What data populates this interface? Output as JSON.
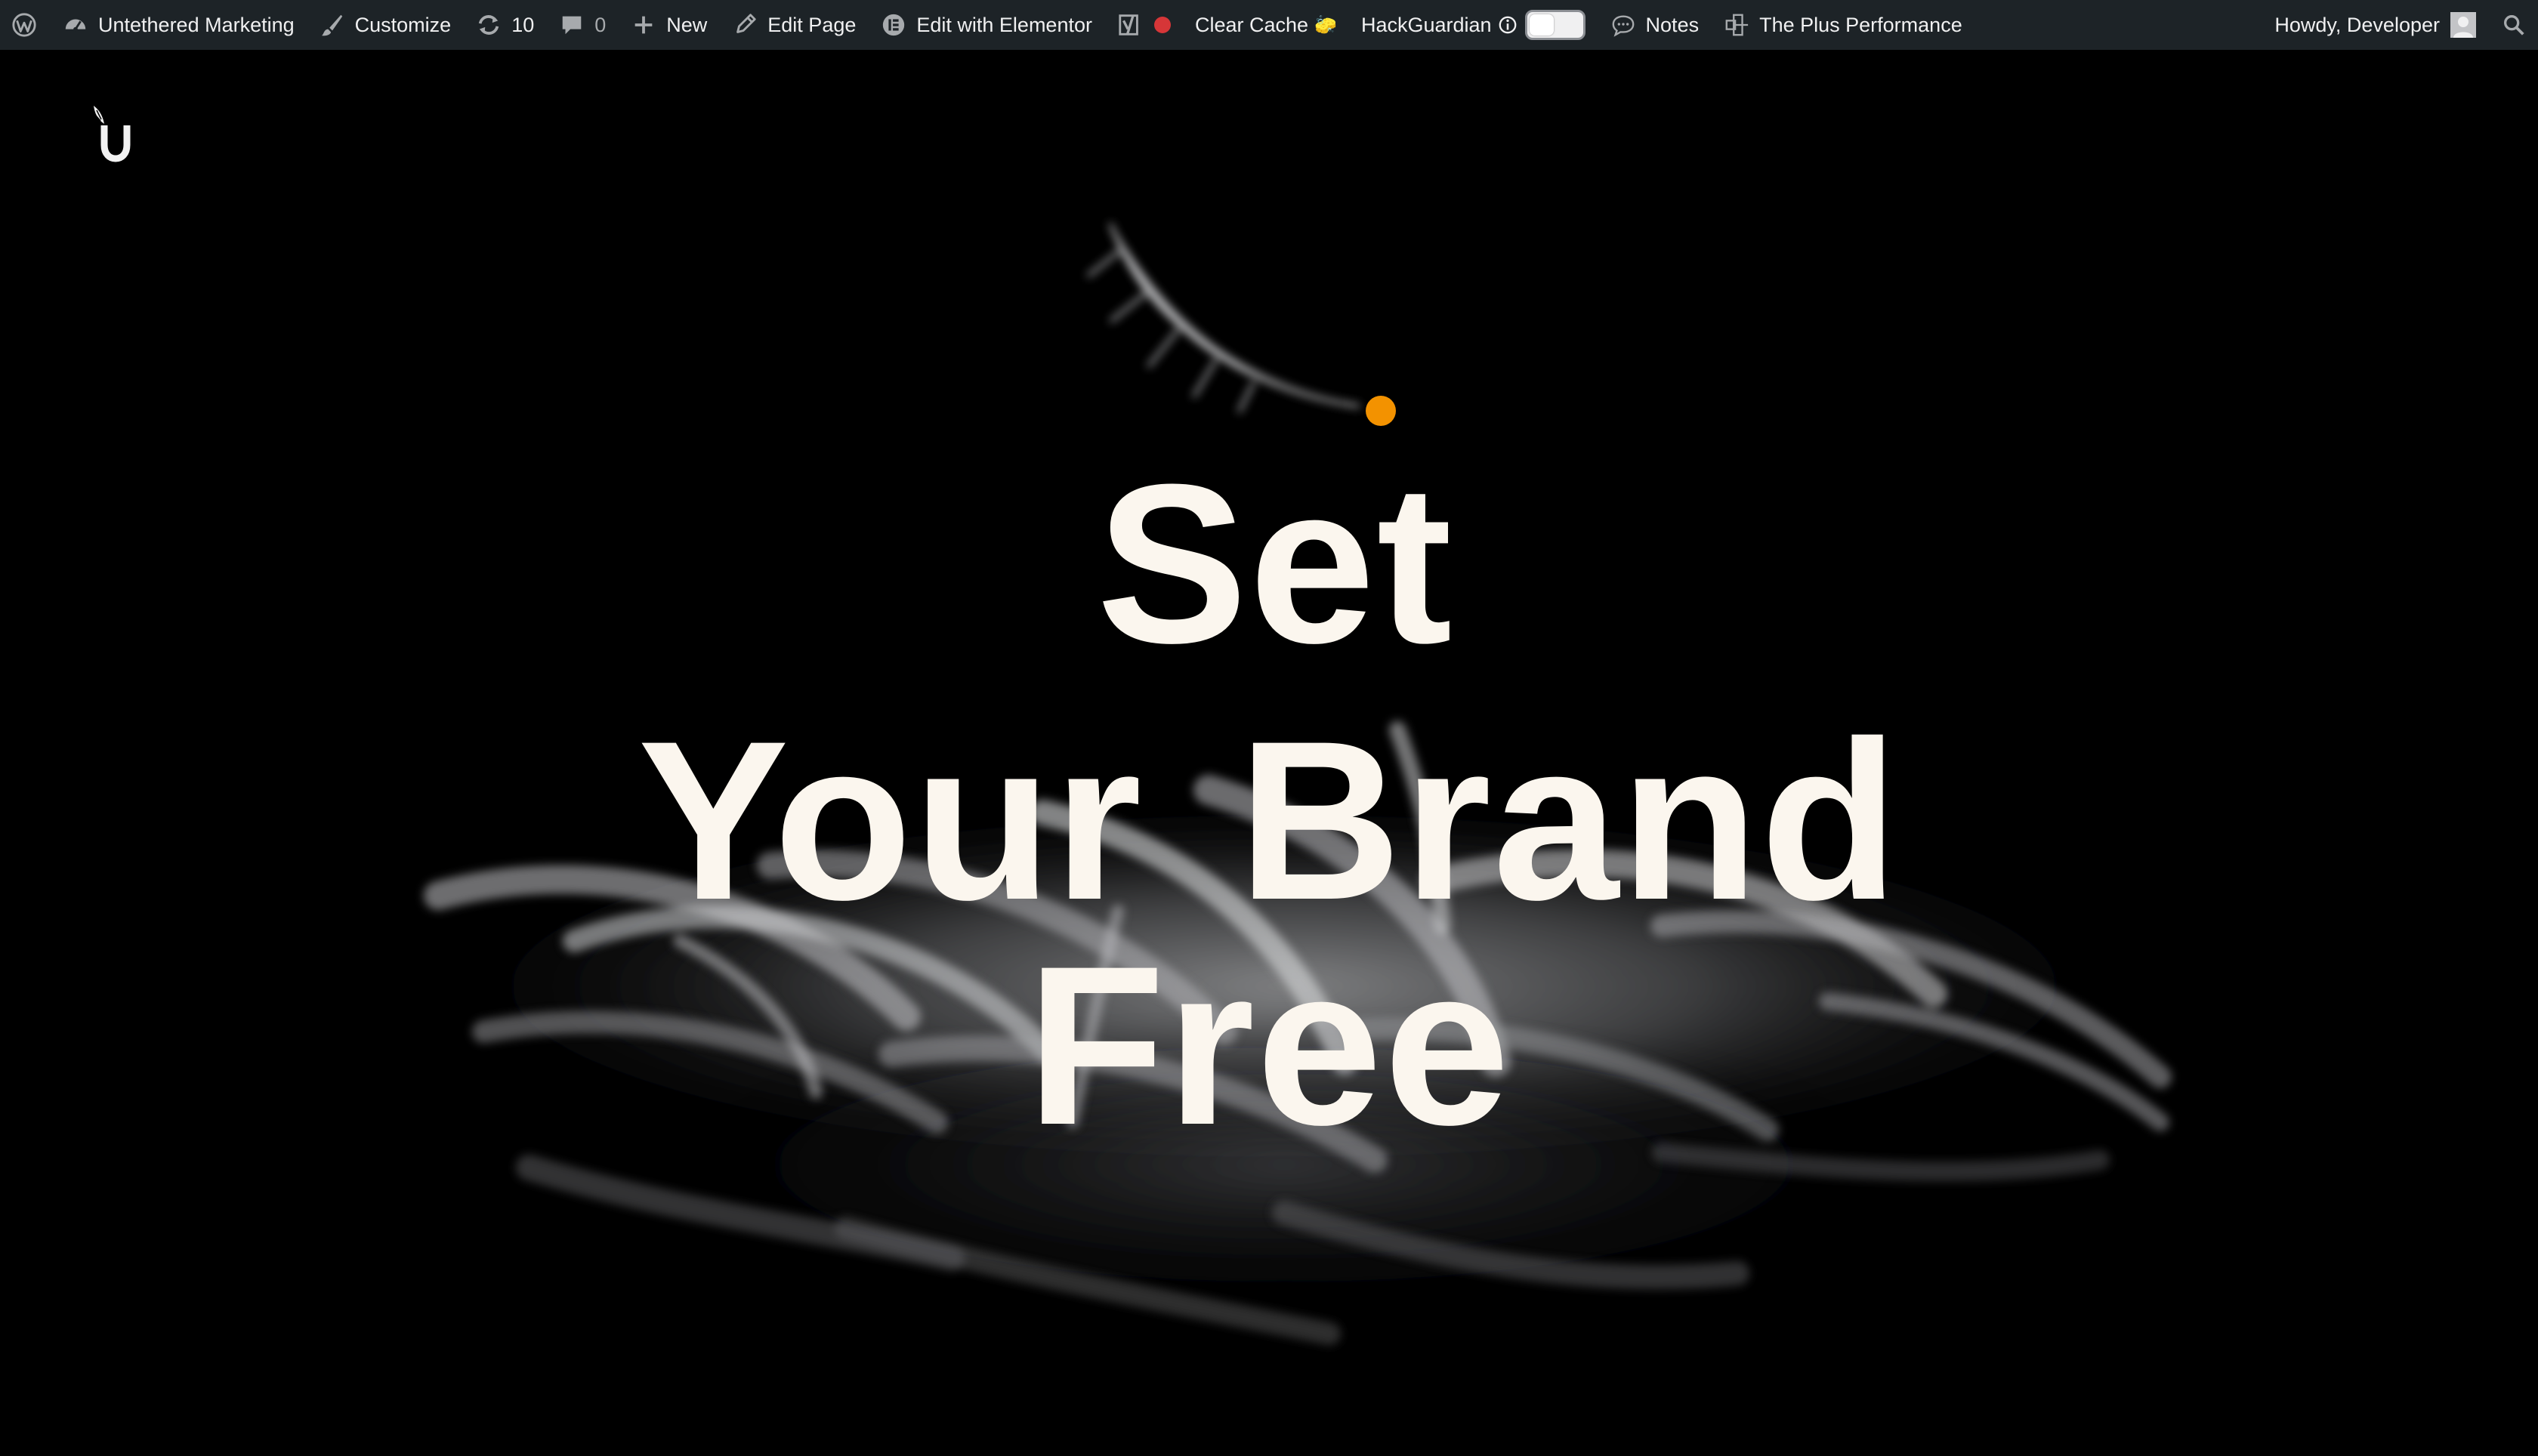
{
  "adminbar": {
    "wp_logo_icon": "wordpress-icon",
    "site_name": "Untethered Marketing",
    "customize_label": "Customize",
    "updates_count": "10",
    "comments_count": "0",
    "new_label": "New",
    "edit_page_label": "Edit Page",
    "elementor_label": "Edit with Elementor",
    "yoast_icon": "yoast-icon",
    "clear_cache_label": "Clear Cache",
    "clear_cache_emoji": "🧽",
    "hackguardian_label": "HackGuardian",
    "hackguardian_info_icon": "info-icon",
    "notes_label": "Notes",
    "plus_performance_label": "The Plus Performance",
    "howdy_label": "Howdy, Developer",
    "search_icon": "search-icon"
  },
  "hero": {
    "line1": "Set",
    "line2": "Your Brand",
    "line3": "Free"
  },
  "colors": {
    "adminbar_bg": "#1d2327",
    "adminbar_text": "#f0f0f1",
    "status_red": "#d63638",
    "accent_orange": "#f39200",
    "headline_text": "#fbf6ee",
    "page_bg": "#000000"
  }
}
